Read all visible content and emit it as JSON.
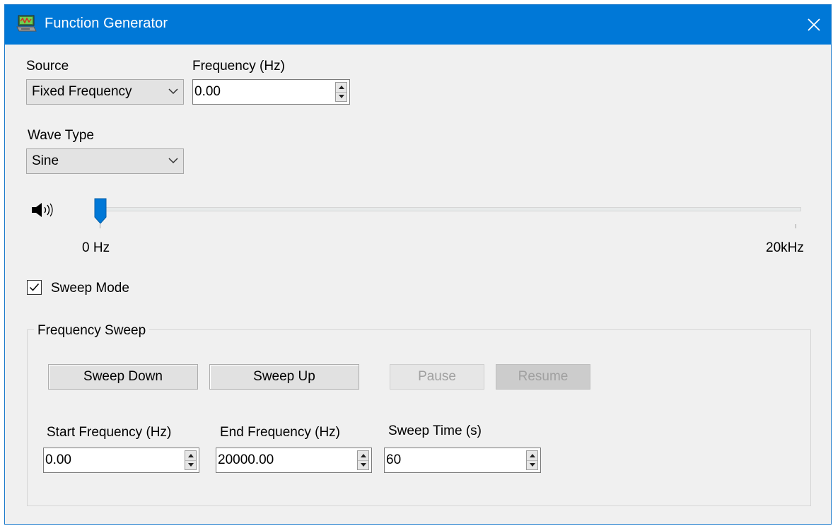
{
  "window": {
    "title": "Function Generator",
    "title_icon": "function-generator-app-icon",
    "close_icon": "close-icon"
  },
  "source": {
    "label": "Source",
    "selected": "Fixed Frequency"
  },
  "frequency": {
    "label": "Frequency (Hz)",
    "value": "0.00"
  },
  "wave_type": {
    "label": "Wave Type",
    "selected": "Sine"
  },
  "slider": {
    "icon": "speaker-icon",
    "min_label": "0 Hz",
    "max_label": "20kHz",
    "value_fraction": 0.0
  },
  "sweep_mode": {
    "label": "Sweep Mode",
    "checked": true
  },
  "frequency_sweep": {
    "title": "Frequency Sweep",
    "buttons": {
      "sweep_down": "Sweep Down",
      "sweep_up": "Sweep Up",
      "pause": "Pause",
      "resume": "Resume"
    },
    "start_frequency": {
      "label": "Start Frequency (Hz)",
      "value": "0.00"
    },
    "end_frequency": {
      "label": "End Frequency (Hz)",
      "value": "20000.00"
    },
    "sweep_time": {
      "label": "Sweep Time (s)",
      "value": "60"
    }
  },
  "colors": {
    "titlebar": "#0078d7",
    "slider_thumb": "#0078d7",
    "window_bg": "#f0f0f0"
  }
}
